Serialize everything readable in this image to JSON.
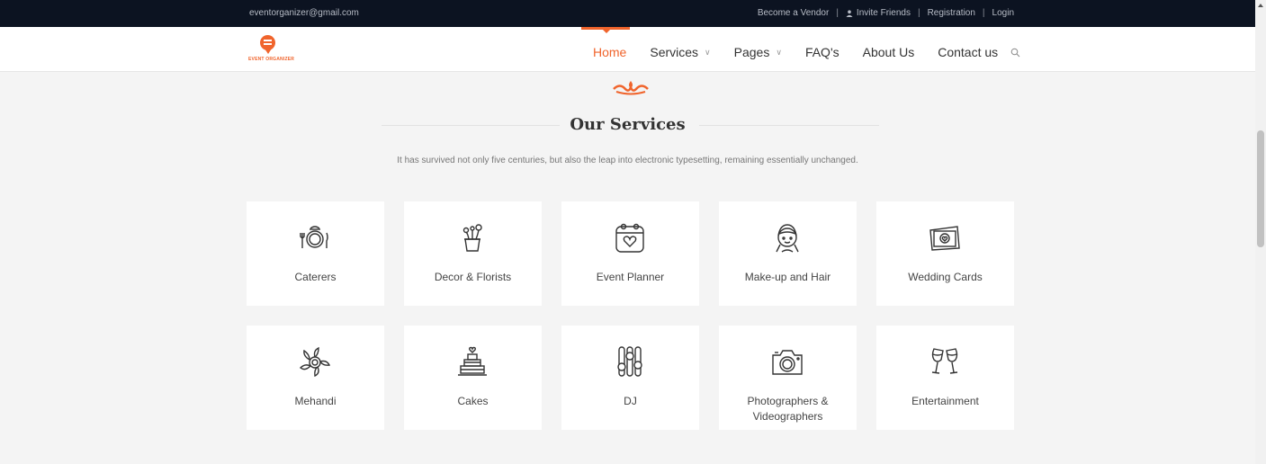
{
  "topbar": {
    "email": "eventorganizer@gmail.com",
    "links": [
      "Become a Vendor",
      "Invite Friends",
      "Registration",
      "Login"
    ]
  },
  "logo": {
    "text": "EVENT ORGANIZER"
  },
  "nav": {
    "items": [
      {
        "label": "Home",
        "active": true,
        "dropdown": false
      },
      {
        "label": "Services",
        "active": false,
        "dropdown": true
      },
      {
        "label": "Pages",
        "active": false,
        "dropdown": true
      },
      {
        "label": "FAQ's",
        "active": false,
        "dropdown": false
      },
      {
        "label": "About Us",
        "active": false,
        "dropdown": false
      },
      {
        "label": "Contact us",
        "active": false,
        "dropdown": false
      }
    ]
  },
  "section": {
    "title": "Our Services",
    "subtitle": "It has survived not only five centuries, but also the leap into electronic typesetting, remaining essentially unchanged."
  },
  "services": [
    {
      "label": "Caterers",
      "icon": "plate-cutlery-icon"
    },
    {
      "label": "Decor & Florists",
      "icon": "flower-pot-icon"
    },
    {
      "label": "Event Planner",
      "icon": "calendar-heart-icon"
    },
    {
      "label": "Make-up and Hair",
      "icon": "woman-face-icon"
    },
    {
      "label": "Wedding Cards",
      "icon": "card-heart-icon"
    },
    {
      "label": "Mehandi",
      "icon": "henna-flower-icon"
    },
    {
      "label": "Cakes",
      "icon": "tiered-cake-icon"
    },
    {
      "label": "DJ",
      "icon": "mixer-sliders-icon"
    },
    {
      "label": "Photographers & Videographers",
      "icon": "camera-icon"
    },
    {
      "label": "Entertainment",
      "icon": "toast-glasses-icon"
    }
  ],
  "colors": {
    "accent": "#f0642c",
    "topbar": "#0c1321",
    "background": "#f4f4f4"
  }
}
